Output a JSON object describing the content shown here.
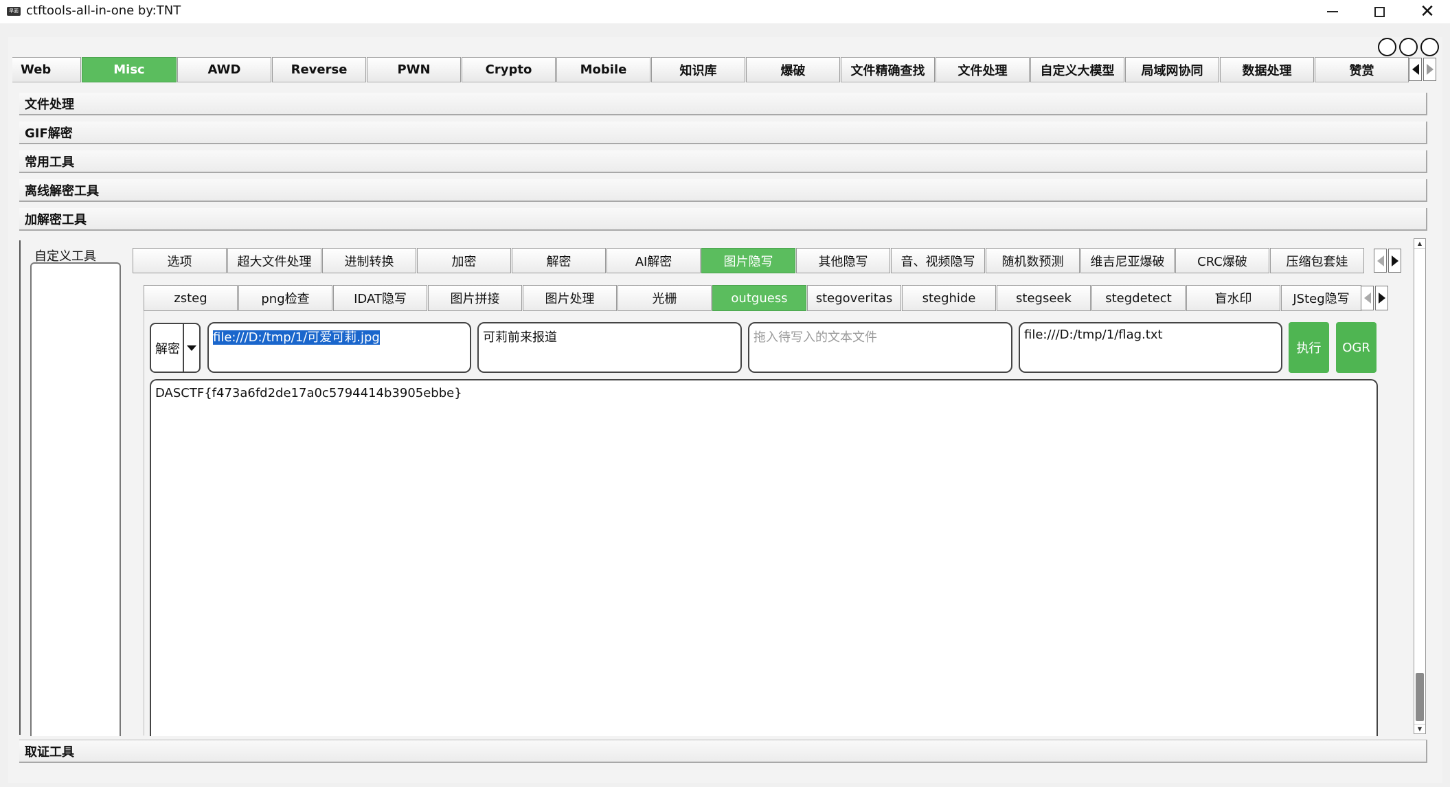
{
  "window": {
    "title": "ctftools-all-in-one   by:TNT",
    "icon_text": "早面"
  },
  "main_tabs": {
    "items": [
      {
        "label": "Web"
      },
      {
        "label": "Misc",
        "active": true
      },
      {
        "label": "AWD"
      },
      {
        "label": "Reverse"
      },
      {
        "label": "PWN"
      },
      {
        "label": "Crypto"
      },
      {
        "label": "Mobile"
      },
      {
        "label": "知识库"
      },
      {
        "label": "爆破"
      },
      {
        "label": "文件精确查找"
      },
      {
        "label": "文件处理"
      },
      {
        "label": "自定义大模型"
      },
      {
        "label": "局域网协同"
      },
      {
        "label": "数据处理"
      },
      {
        "label": "赞赏"
      }
    ]
  },
  "sections": {
    "items": [
      {
        "label": "文件处理"
      },
      {
        "label": "GIF解密"
      },
      {
        "label": "常用工具"
      },
      {
        "label": "离线解密工具"
      },
      {
        "label": "加解密工具"
      }
    ],
    "bottom": "取证工具"
  },
  "left_panel": {
    "label": "自定义工具"
  },
  "sub_tabs": {
    "items": [
      {
        "label": "选项"
      },
      {
        "label": "超大文件处理"
      },
      {
        "label": "进制转换"
      },
      {
        "label": "加密"
      },
      {
        "label": "解密"
      },
      {
        "label": "AI解密"
      },
      {
        "label": "图片隐写",
        "active": true
      },
      {
        "label": "其他隐写"
      },
      {
        "label": "音、视频隐写"
      },
      {
        "label": "随机数预测"
      },
      {
        "label": "维吉尼亚爆破"
      },
      {
        "label": "CRC爆破"
      },
      {
        "label": "压缩包套娃"
      }
    ]
  },
  "tool_tabs": {
    "items": [
      {
        "label": "zsteg"
      },
      {
        "label": "png检查"
      },
      {
        "label": "IDAT隐写"
      },
      {
        "label": "图片拼接"
      },
      {
        "label": "图片处理"
      },
      {
        "label": "光栅"
      },
      {
        "label": "outguess",
        "active": true
      },
      {
        "label": "stegoveritas"
      },
      {
        "label": "steghide"
      },
      {
        "label": "stegseek"
      },
      {
        "label": "stegdetect"
      },
      {
        "label": "盲水印"
      },
      {
        "label": "JSteg隐写"
      }
    ]
  },
  "controls": {
    "mode_value": "解密",
    "input_file": "file:///D:/tmp/1/可爱可莉.jpg",
    "key_value": "可莉前来报道",
    "text_file_placeholder": "拖入待写入的文本文件",
    "output_file": "file:///D:/tmp/1/flag.txt",
    "execute_label": "执行",
    "ogr_label": "OGR"
  },
  "output": {
    "text": "DASCTF{f473a6fd2de17a0c5794414b3905ebbe}"
  },
  "colors": {
    "active_tab": "#5bbd5e",
    "selection": "#1a66cc",
    "button_green": "#4fb552"
  }
}
